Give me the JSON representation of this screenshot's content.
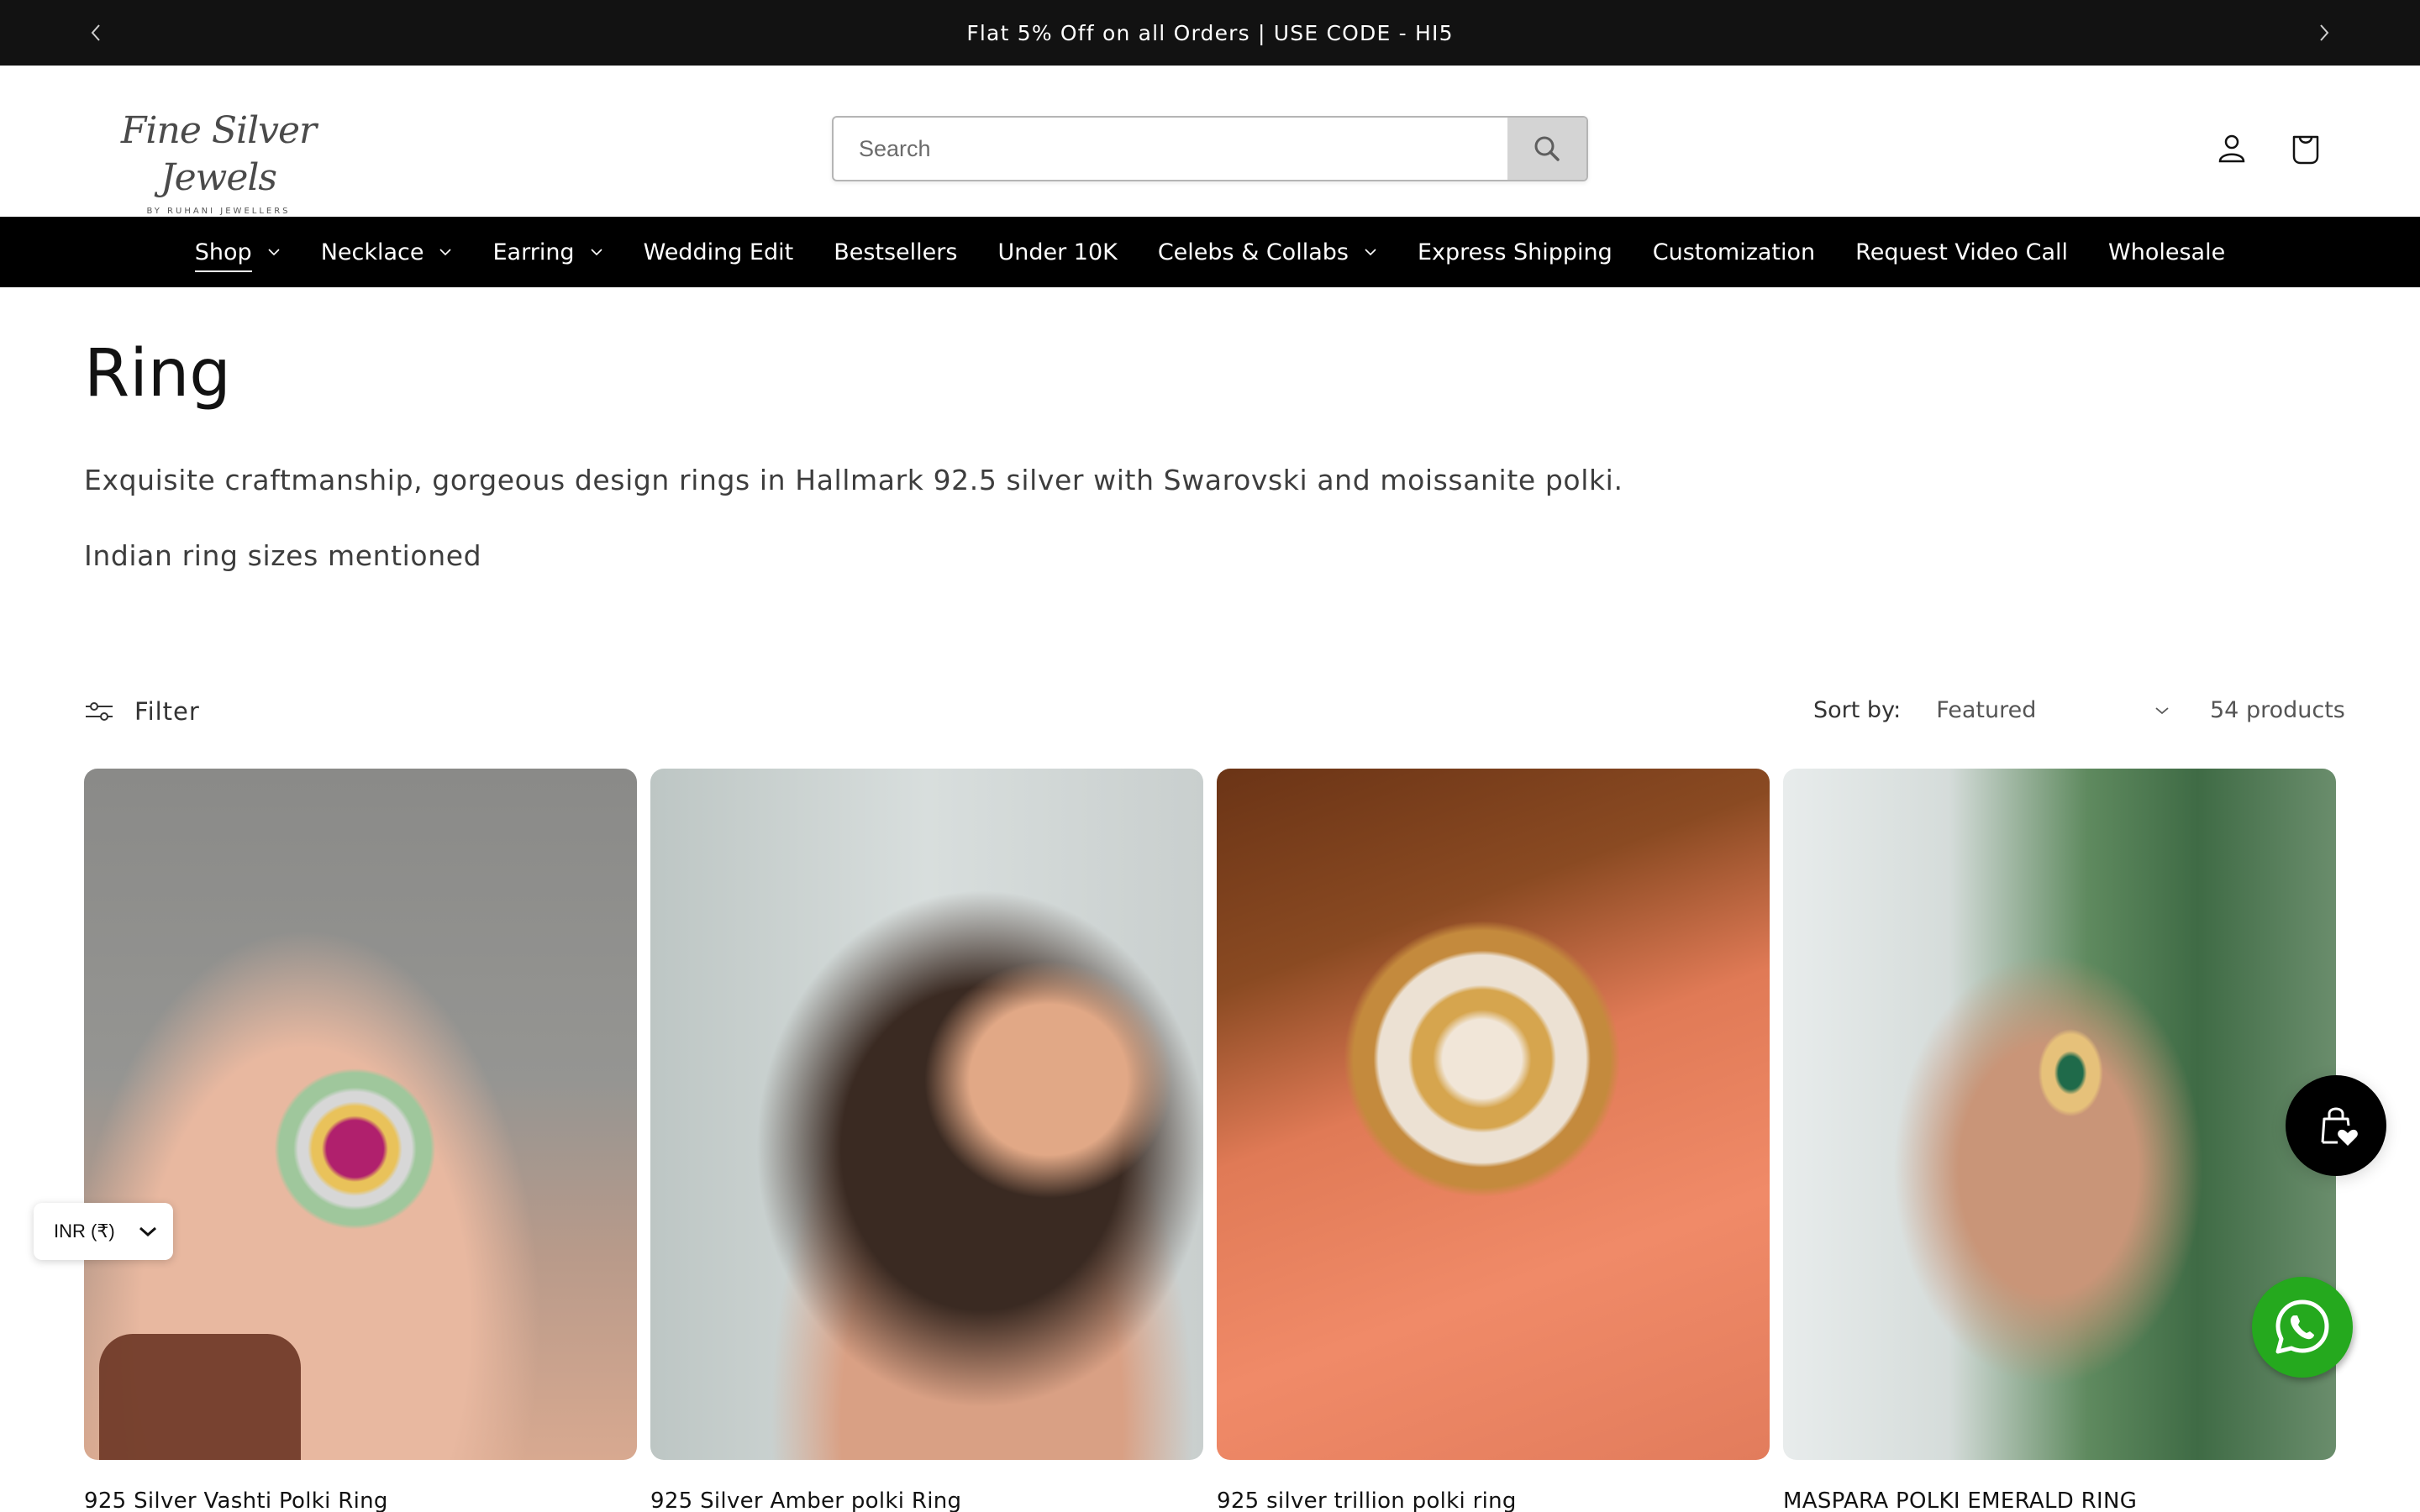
{
  "announcement": {
    "message": "Flat 5% Off on all Orders | USE CODE - HI5",
    "prev_icon": "chevron-left-icon",
    "next_icon": "chevron-right-icon"
  },
  "header": {
    "logo": {
      "title": "Fine Silver Jewels",
      "subtitle": "BY RUHANI JEWELLERS"
    },
    "search": {
      "placeholder": "Search",
      "value": "",
      "icon": "search-icon"
    },
    "icons": {
      "account": "user-icon",
      "cart": "shopping-bag-icon"
    }
  },
  "nav": {
    "items": [
      {
        "label": "Shop",
        "has_dropdown": true,
        "active": true
      },
      {
        "label": "Necklace",
        "has_dropdown": true
      },
      {
        "label": "Earring",
        "has_dropdown": true
      },
      {
        "label": "Wedding Edit",
        "has_dropdown": false
      },
      {
        "label": "Bestsellers",
        "has_dropdown": false
      },
      {
        "label": "Under 10K",
        "has_dropdown": false
      },
      {
        "label": "Celebs & Collabs",
        "has_dropdown": true
      },
      {
        "label": "Express Shipping",
        "has_dropdown": false
      },
      {
        "label": "Customization",
        "has_dropdown": false
      },
      {
        "label": "Request Video Call",
        "has_dropdown": false
      },
      {
        "label": "Wholesale",
        "has_dropdown": false
      }
    ]
  },
  "collection": {
    "title": "Ring",
    "description": [
      "Exquisite craftmanship, gorgeous design rings in Hallmark 92.5 silver with Swarovski and moissanite polki.",
      "Indian ring sizes mentioned"
    ]
  },
  "toolbar": {
    "filter_label": "Filter",
    "sort_label": "Sort by:",
    "sort_value": "Featured",
    "product_count": "54 products"
  },
  "products": [
    {
      "name": "925 Silver Vashti Polki Ring"
    },
    {
      "name": "925 Silver Amber polki Ring"
    },
    {
      "name": "925 silver trillion polki ring"
    },
    {
      "name": "MASPARA POLKI EMERALD RING"
    }
  ],
  "widgets": {
    "currency": "INR (₹)",
    "wishlist_icon": "bag-heart-icon",
    "whatsapp_icon": "whatsapp-icon"
  },
  "colors": {
    "announcement_bg": "#121212",
    "nav_bg": "#000000",
    "search_button_bg": "#d4d4d4",
    "whatsapp_green": "#25a91e"
  }
}
